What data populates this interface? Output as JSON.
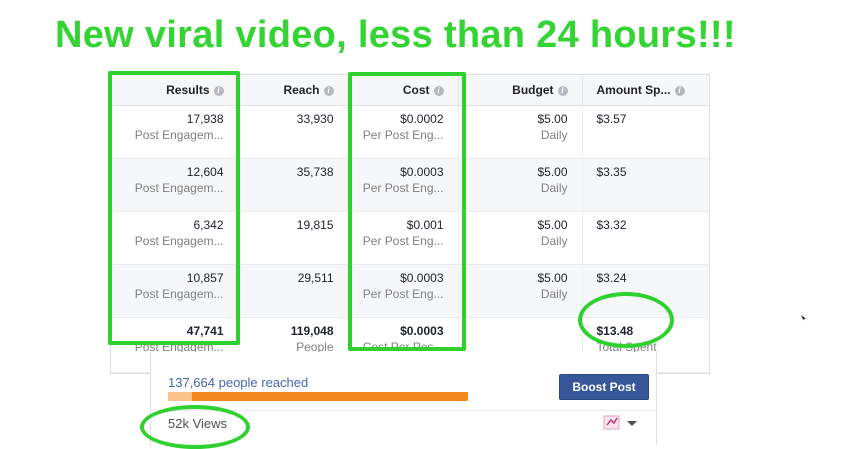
{
  "headline": "New viral video, less than 24 hours!!!",
  "table": {
    "columns": [
      {
        "label": "Results"
      },
      {
        "label": "Reach"
      },
      {
        "label": "Cost"
      },
      {
        "label": "Budget"
      },
      {
        "label": "Amount Sp..."
      }
    ],
    "rows": [
      {
        "results": "17,938",
        "results_sub": "Post Engagem...",
        "reach": "33,930",
        "cost": "$0.0002",
        "cost_sub": "Per Post Eng...",
        "budget": "$5.00",
        "budget_sub": "Daily",
        "amount": "$3.57"
      },
      {
        "results": "12,604",
        "results_sub": "Post Engagem...",
        "reach": "35,738",
        "cost": "$0.0003",
        "cost_sub": "Per Post Eng...",
        "budget": "$5.00",
        "budget_sub": "Daily",
        "amount": "$3.35"
      },
      {
        "results": "6,342",
        "results_sub": "Post Engagem...",
        "reach": "19,815",
        "cost": "$0.001",
        "cost_sub": "Per Post Eng...",
        "budget": "$5.00",
        "budget_sub": "Daily",
        "amount": "$3.32"
      },
      {
        "results": "10,857",
        "results_sub": "Post Engagem...",
        "reach": "29,511",
        "cost": "$0.0003",
        "cost_sub": "Per Post Eng...",
        "budget": "$5.00",
        "budget_sub": "Daily",
        "amount": "$3.24"
      }
    ],
    "total": {
      "results": "47,741",
      "results_sub": "Post Engagem...",
      "reach": "119,048",
      "reach_sub": "People",
      "cost": "$0.0003",
      "cost_sub": "Cost Per Pos...",
      "amount": "$13.48",
      "amount_sub": "Total Spent"
    }
  },
  "post": {
    "reached": "137,664 people reached",
    "organic_fraction": 0.08,
    "boost_label": "Boost Post",
    "views": "52k Views"
  },
  "colors": {
    "highlight": "#2fd12f",
    "headline": "#33d433",
    "boost_bg": "#365899",
    "bar_paid": "#f48a1f",
    "bar_organic": "#f9c28a",
    "link": "#4267b2"
  }
}
